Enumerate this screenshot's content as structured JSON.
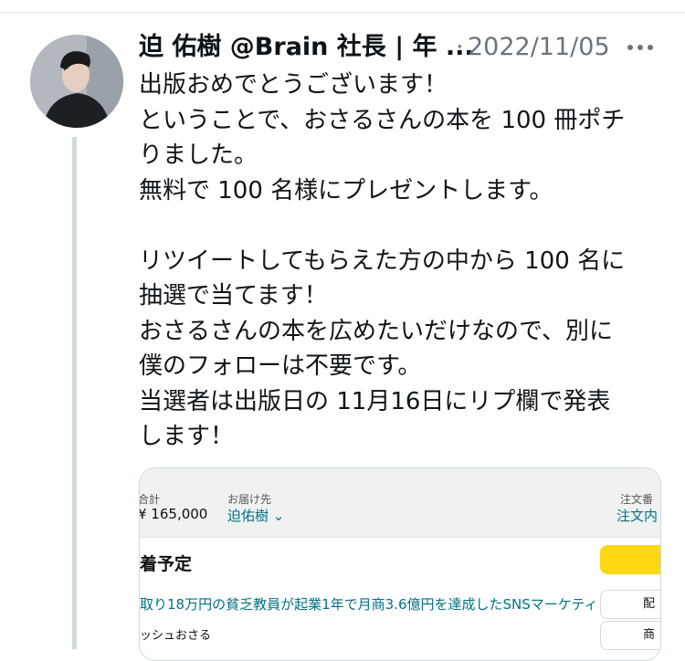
{
  "tweet": {
    "author": "迫 佑樹 @Brain 社長 | 年 ...",
    "separator": "·",
    "date": "2022/11/05",
    "more_icon": "more-horizontal-icon",
    "lines": [
      "出版おめでとうございます！",
      "ということで、おさるさんの本を 100 冊ポチ",
      "りました。",
      "無料で 100 名様にプレゼントします。",
      "",
      "リツイートしてもらえた方の中から 100 名に",
      "抽選で当てます！",
      "おさるさんの本を広めたいだけなので、別に",
      "僕のフォローは不要です。",
      "当選者は出版日の 11月16日にリプ欄で発表",
      "します！"
    ]
  },
  "order": {
    "total_label": "合計",
    "total_value": "¥ 165,000",
    "ship_to_label": "お届け先",
    "ship_to_value": "迫佑樹 ⌄",
    "order_no_label": "注文番",
    "order_details_link": "注文内",
    "arrival_title": "着予定",
    "product_title": "取り18万円の貧乏教員が起業1年で月商3.6億円を達成したSNSマーケティ",
    "seller": "ッシュおさる",
    "button_1": "配",
    "button_2": "商"
  },
  "colors": {
    "text": "#0f1419",
    "secondary": "#6b747c",
    "link": "#007185",
    "button_yellow": "#ffd814"
  }
}
